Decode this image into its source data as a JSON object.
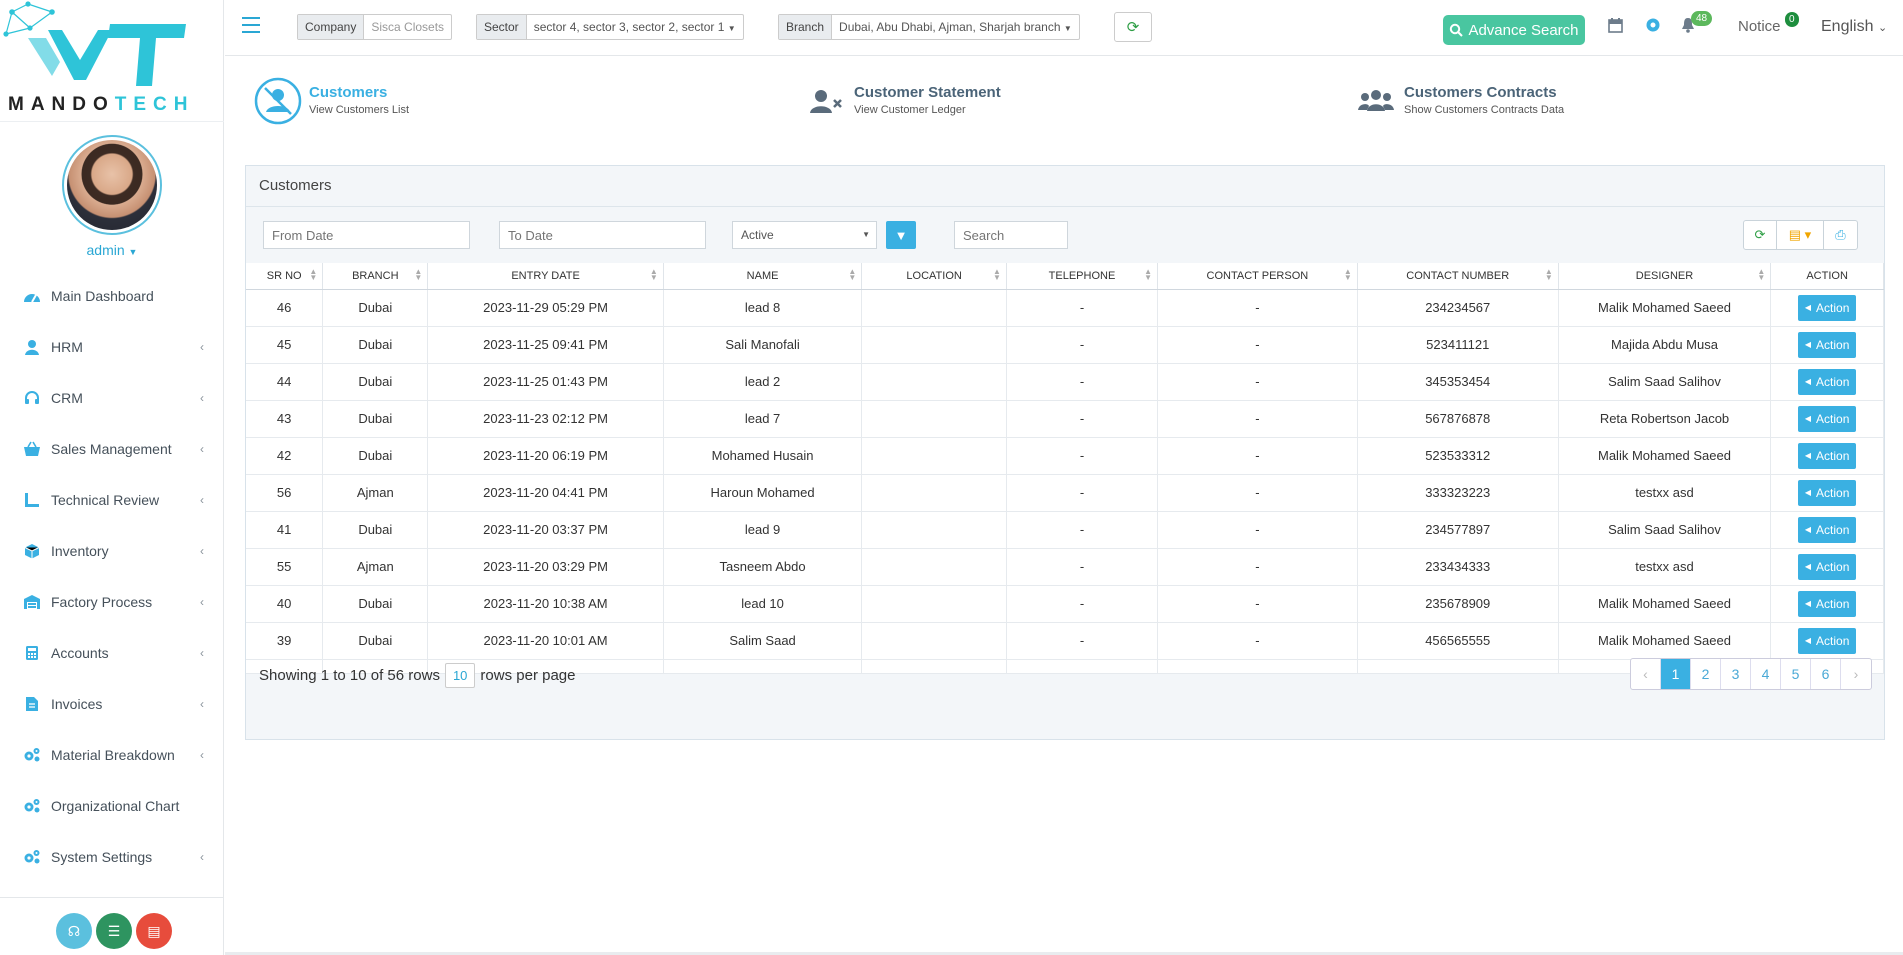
{
  "brand": {
    "text_a": "MANDO",
    "text_b": "TECH"
  },
  "user": {
    "name": "admin"
  },
  "sidebar": {
    "items": [
      {
        "label": "Main Dashboard",
        "icon": "dashboard-icon",
        "sub": false
      },
      {
        "label": "HRM",
        "icon": "user-icon",
        "sub": true
      },
      {
        "label": "CRM",
        "icon": "headset-icon",
        "sub": true
      },
      {
        "label": "Sales Management",
        "icon": "basket-icon",
        "sub": true
      },
      {
        "label": "Technical Review",
        "icon": "ruler-icon",
        "sub": true
      },
      {
        "label": "Inventory",
        "icon": "box-icon",
        "sub": true
      },
      {
        "label": "Factory Process",
        "icon": "warehouse-icon",
        "sub": true
      },
      {
        "label": "Accounts",
        "icon": "calculator-icon",
        "sub": true
      },
      {
        "label": "Invoices",
        "icon": "file-icon",
        "sub": true
      },
      {
        "label": "Material Breakdown",
        "icon": "cogs-icon",
        "sub": true
      },
      {
        "label": "Organizational Chart",
        "icon": "cogs-icon",
        "sub": false
      },
      {
        "label": "System Settings",
        "icon": "cogs-icon",
        "sub": true
      }
    ],
    "footer_buttons": [
      {
        "icon": "support-icon",
        "color": "#5bc0de"
      },
      {
        "icon": "list-check-icon",
        "color": "#2e9460"
      },
      {
        "icon": "clipboard-icon",
        "color": "#e74c3c"
      }
    ]
  },
  "header": {
    "company": {
      "label": "Company",
      "value": "Sisca Closets"
    },
    "sector": {
      "label": "Sector",
      "value": "sector 4, sector 3, sector 2, sector 1"
    },
    "branch": {
      "label": "Branch",
      "value": "Dubai, Abu Dhabi, Ajman, Sharjah branch"
    },
    "advance_search": "Advance Search",
    "notifications_count": "48",
    "notice": "Notice",
    "notice_count": "0",
    "language": "English"
  },
  "shortcuts": [
    {
      "title": "Customers",
      "subtitle": "View Customers List"
    },
    {
      "title": "Customer Statement",
      "subtitle": "View Customer Ledger"
    },
    {
      "title": "Customers Contracts",
      "subtitle": "Show Customers Contracts Data"
    }
  ],
  "panel": {
    "title": "Customers",
    "from_placeholder": "From Date",
    "to_placeholder": "To Date",
    "status": "Active",
    "search_placeholder": "Search"
  },
  "table": {
    "columns": [
      "SR NO",
      "BRANCH",
      "ENTRY DATE",
      "NAME",
      "LOCATION",
      "TELEPHONE",
      "CONTACT PERSON",
      "CONTACT NUMBER",
      "DESIGNER",
      "ACTION"
    ],
    "action_label": "Action",
    "rows": [
      [
        "46",
        "Dubai",
        "2023-11-29 05:29 PM",
        "lead 8",
        "",
        "-",
        "-",
        "234234567",
        "Malik Mohamed Saeed"
      ],
      [
        "45",
        "Dubai",
        "2023-11-25 09:41 PM",
        "Sali Manofali",
        "",
        "-",
        "-",
        "523411121",
        "Majida Abdu Musa"
      ],
      [
        "44",
        "Dubai",
        "2023-11-25 01:43 PM",
        "lead 2",
        "",
        "-",
        "-",
        "345353454",
        "Salim Saad Salihov"
      ],
      [
        "43",
        "Dubai",
        "2023-11-23 02:12 PM",
        "lead 7",
        "",
        "-",
        "-",
        "567876878",
        "Reta Robertson Jacob"
      ],
      [
        "42",
        "Dubai",
        "2023-11-20 06:19 PM",
        "Mohamed Husain",
        "",
        "-",
        "-",
        "523533312",
        "Malik Mohamed Saeed"
      ],
      [
        "56",
        "Ajman",
        "2023-11-20 04:41 PM",
        "Haroun Mohamed",
        "",
        "-",
        "-",
        "333323223",
        "testxx asd"
      ],
      [
        "41",
        "Dubai",
        "2023-11-20 03:37 PM",
        "lead 9",
        "",
        "-",
        "-",
        "234577897",
        "Salim Saad Salihov"
      ],
      [
        "55",
        "Ajman",
        "2023-11-20 03:29 PM",
        "Tasneem Abdo",
        "",
        "-",
        "-",
        "233434333",
        "testxx asd"
      ],
      [
        "40",
        "Dubai",
        "2023-11-20 10:38 AM",
        "lead 10",
        "",
        "-",
        "-",
        "235678909",
        "Malik Mohamed Saeed"
      ],
      [
        "39",
        "Dubai",
        "2023-11-20 10:01 AM",
        "Salim Saad",
        "",
        "-",
        "-",
        "456565555",
        "Malik Mohamed Saeed"
      ]
    ]
  },
  "pagination": {
    "showing": "Showing 1 to 10 of 56 rows",
    "per_page": "10",
    "per_page_suffix": "rows per page",
    "prev": "‹",
    "next": "›",
    "pages": [
      "1",
      "2",
      "3",
      "4",
      "5",
      "6"
    ],
    "active": "1"
  }
}
